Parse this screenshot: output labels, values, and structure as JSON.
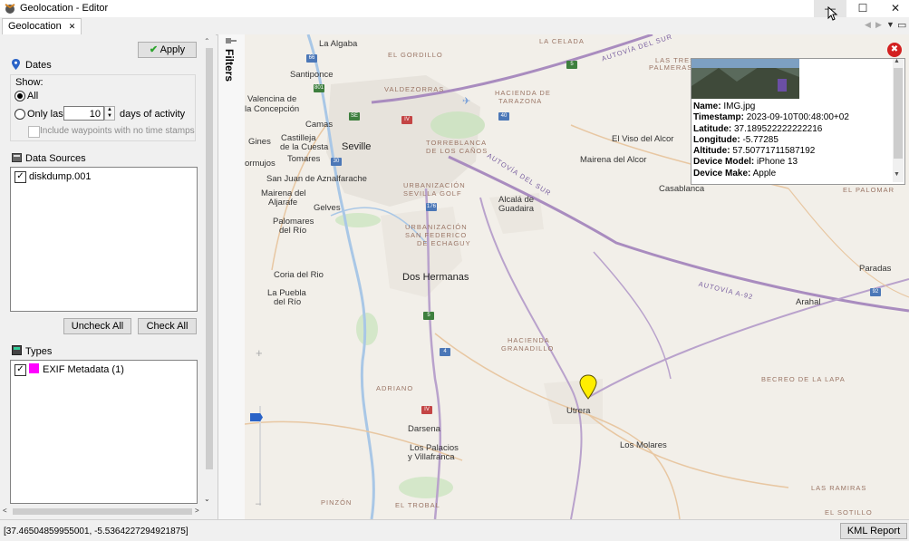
{
  "window": {
    "title": "Geolocation - Editor",
    "minimize_glyph": "—",
    "maximize_glyph": "☐",
    "close_glyph": "✕"
  },
  "tabs": [
    {
      "label": "Geolocation",
      "close": "✕"
    }
  ],
  "panel": {
    "apply_label": "Apply",
    "dates": {
      "title": "Dates",
      "show_label": "Show:",
      "all_label": "All",
      "all_selected": true,
      "only_last_label": "Only last",
      "days_value": "10",
      "days_suffix": "days of activity",
      "include_waypoints_label": "Include waypoints with no time stamps"
    },
    "data_sources": {
      "title": "Data Sources",
      "items": [
        {
          "label": "diskdump.001",
          "checked": true
        }
      ]
    },
    "uncheck_all_label": "Uncheck All",
    "check_all_label": "Check All",
    "types": {
      "title": "Types",
      "items": [
        {
          "label": "EXIF Metadata (1)",
          "checked": true,
          "color": "#ff00ff"
        }
      ]
    }
  },
  "filters_label": "Filters",
  "map": {
    "places": [
      "La Algaba",
      "Santiponce",
      "Valencina de",
      "la Concepción",
      "Camas",
      "Gines",
      "Castilleja",
      "de la Cuesta",
      "Seville",
      "ormujos",
      "Tomares",
      "San Juan de Aznalfarache",
      "Mairena del",
      "Aljarafe",
      "Gelves",
      "Palomares",
      "del Río",
      "Coria del Rio",
      "La Puebla",
      "del Río",
      "Dos Hermanas",
      "El Viso del Alcor",
      "Mairena del Alcor",
      "Alcalá de",
      "Guadaira",
      "Casablanca",
      "Paradas",
      "Arahal",
      "Utrera",
      "Darsena",
      "Los Palacios",
      "y Villafranca",
      "Los Molares"
    ],
    "areas": [
      "LA CELADA",
      "EL GORDILLO",
      "VALDEZORRAS",
      "HACIENDA DE",
      "TARAZONA",
      "LAS TRES",
      "PALMERAS",
      "TORREBLANCA",
      "DE LOS CAÑOS",
      "URBANIZACIÓN",
      "SEVILLA GOLF",
      "URBANIZACIÓN",
      "SAN FEDERICO",
      "DE ECHAGUY",
      "EL PALOMAR",
      "HACIENDA",
      "GRANADILLO",
      "ADRIANO",
      "BECREO DE LA LAPA",
      "LAS RAMIRAS",
      "PINZÓN",
      "EL TROBAL",
      "EL SOTILLO"
    ],
    "roads": [
      "66",
      "801",
      "SE",
      "40",
      "IV",
      "30",
      "176",
      "5",
      "4",
      "IV",
      "5",
      "92",
      "A-92",
      "Autovía del Sur",
      "Autovía A-92",
      "Autovía A-92"
    ],
    "marker_color": "#ffee00"
  },
  "popup": {
    "fields": [
      {
        "label": "Name:",
        "value": "IMG.jpg"
      },
      {
        "label": "Timestamp:",
        "value": "2023-09-10T00:48:00+02"
      },
      {
        "label": "Latitude:",
        "value": "37.189522222222216"
      },
      {
        "label": "Longitude:",
        "value": "-5.77285"
      },
      {
        "label": "Altitude:",
        "value": "57.50771711587192"
      },
      {
        "label": "Device Model:",
        "value": "iPhone 13"
      },
      {
        "label": "Device Make:",
        "value": "Apple"
      }
    ],
    "close_glyph": "✖"
  },
  "status": {
    "coordinates": "[37.46504859955001, -5.5364227294921875]",
    "kml_label": "KML Report"
  },
  "colors": {
    "accent_green": "#2ea52e",
    "close_red": "#d32020",
    "road_purple": "#a98cbf",
    "city_fill": "#e7e3dc"
  }
}
